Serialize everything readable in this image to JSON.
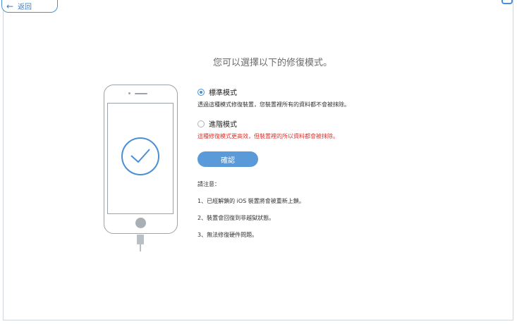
{
  "header": {
    "back_label": "返回",
    "back_arrow": "←"
  },
  "main": {
    "title": "您可以選擇以下的修復模式。",
    "options": [
      {
        "label": "標準模式",
        "selected": true,
        "description": "透過這種模式修復裝置，您裝置裡所有的資料都不會被抹除。"
      },
      {
        "label": "進階模式",
        "selected": false,
        "description": "這種修復模式更高效，但裝置裡的所以資料都會被抹除。"
      }
    ],
    "confirm_label": "確認",
    "notes_title": "請注意：",
    "notes": [
      "1、已經解鎖的 iOS 裝置將會被重新上鎖。",
      "2、裝置會回復到非越獄狀態。",
      "3、無法修復硬件問題。"
    ]
  },
  "colors": {
    "accent": "#4a8fd6",
    "button": "#5b9ad8",
    "warning": "#e0302a"
  }
}
